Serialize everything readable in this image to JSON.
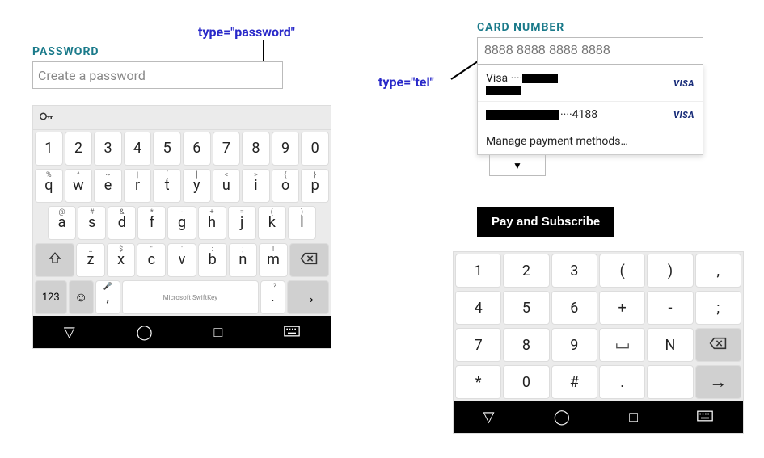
{
  "annotations": {
    "password_type": "type=\"password\"",
    "tel_type": "type=\"tel\""
  },
  "left": {
    "label": "PASSWORD",
    "placeholder": "Create a password",
    "keyboard": {
      "row1": [
        "1",
        "2",
        "3",
        "4",
        "5",
        "6",
        "7",
        "8",
        "9",
        "0"
      ],
      "row2": {
        "subs": [
          "%",
          "^",
          "~",
          "|",
          "[",
          "]",
          "<",
          ">",
          "{",
          "}"
        ],
        "mains": [
          "q",
          "w",
          "e",
          "r",
          "t",
          "y",
          "u",
          "i",
          "o",
          "p"
        ]
      },
      "row3": {
        "subs": [
          "@",
          "#",
          "&",
          "*",
          "-",
          "+",
          "=",
          "(",
          ")"
        ],
        "mains": [
          "a",
          "s",
          "d",
          "f",
          "g",
          "h",
          "j",
          "k",
          "l"
        ]
      },
      "row4": {
        "subs": [
          "_",
          "$",
          "\"",
          "'",
          ":",
          ";",
          "!",
          "?"
        ],
        "mains": [
          "z",
          "x",
          "c",
          "v",
          "b",
          "n",
          "m"
        ]
      },
      "bottom": {
        "numlabel": "123",
        "brand": "Microsoft SwiftKey",
        "dotsub": ".!?",
        "dot": "."
      }
    }
  },
  "right": {
    "label": "CARD NUMBER",
    "placeholder": "8888 8888 8888 8888",
    "dropdown": {
      "item1_text": "Visa ····",
      "item2_text": "····4188",
      "manage": "Manage payment methods…"
    },
    "pay_button": "Pay and Subscribe",
    "numpad": {
      "row1": [
        "1",
        "2",
        "3",
        "(",
        ")",
        ","
      ],
      "row2": [
        "4",
        "5",
        "6",
        "+",
        "-",
        ";"
      ],
      "row3": [
        "7",
        "8",
        "9",
        "",
        "N",
        "⌫"
      ],
      "row4": [
        "*",
        "0",
        "#",
        ".",
        "",
        "→"
      ]
    }
  }
}
